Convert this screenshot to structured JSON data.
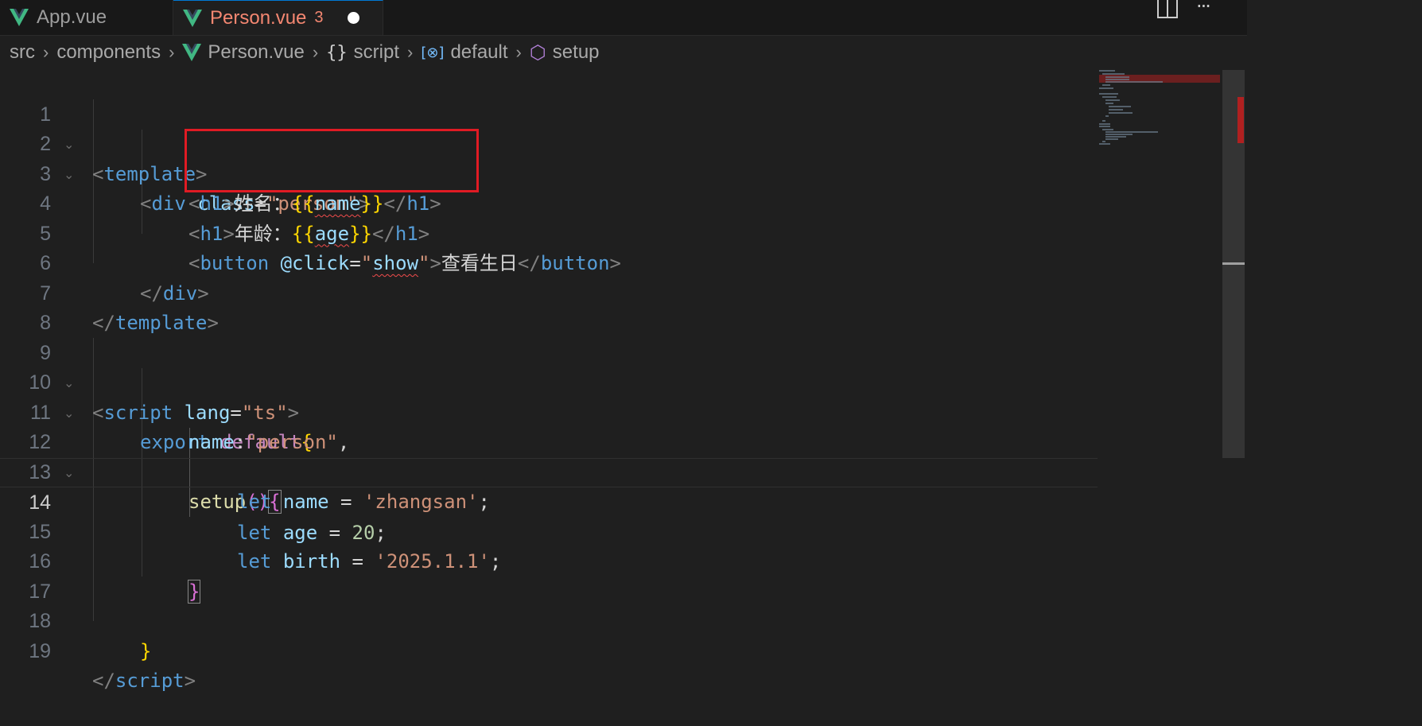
{
  "tabs": [
    {
      "label": "App.vue",
      "active": false
    },
    {
      "label": "Person.vue",
      "active": true,
      "problem_count": "3",
      "unsaved": true
    }
  ],
  "toolbar_icons": [
    "split-editor-icon",
    "more-actions-icon"
  ],
  "toolbar_more_label": "···",
  "breadcrumb": [
    {
      "label": "src"
    },
    {
      "label": "components"
    },
    {
      "label": "Person.vue",
      "icon": "vue-icon"
    },
    {
      "label": "script",
      "icon": "braces-icon",
      "icon_glyph": "{}"
    },
    {
      "label": "default",
      "icon": "namespace-icon",
      "icon_glyph": "[⊗]"
    },
    {
      "label": "setup",
      "icon": "cube-icon",
      "icon_glyph": "⬡"
    }
  ],
  "editor": {
    "current_line": 14,
    "line_numbers": [
      "1",
      "2",
      "3",
      "4",
      "5",
      "6",
      "7",
      "8",
      "9",
      "10",
      "11",
      "12",
      "13",
      "14",
      "15",
      "16",
      "17",
      "18",
      "19"
    ],
    "fold_glyph": "⌄",
    "tokens": {
      "l1": [
        "<",
        "template",
        ">"
      ],
      "l2": [
        "<",
        "div",
        " ",
        "class",
        "=",
        "\"person\"",
        ">"
      ],
      "l3": [
        "<",
        "h1",
        ">",
        "姓名：",
        "{{",
        "name",
        "}}",
        "</",
        "h1",
        ">"
      ],
      "l4": [
        "<",
        "h1",
        ">",
        "年龄：",
        "{{",
        "age",
        "}}",
        "</",
        "h1",
        ">"
      ],
      "l5": [
        "<",
        "button",
        " ",
        "@click",
        "=",
        "\"",
        "show",
        "\"",
        ">",
        "查看生日",
        "</",
        "button",
        ">"
      ],
      "l6": [
        "</",
        "div",
        ">"
      ],
      "l7": [
        "</",
        "template",
        ">"
      ],
      "l9": [
        "<",
        "script",
        " ",
        "lang",
        "=",
        "\"ts\"",
        ">"
      ],
      "l10": [
        "export",
        " ",
        "default",
        "{"
      ],
      "l11": [
        "name",
        ":",
        "\"person\"",
        ","
      ],
      "l12": [
        "setup",
        "()",
        "{"
      ],
      "l13": [
        "let",
        " ",
        "name",
        " = ",
        "'zhangsan'",
        ";"
      ],
      "l14": [
        "let",
        " ",
        "age",
        " = ",
        "20",
        ";"
      ],
      "l15": [
        "let",
        " ",
        "birth",
        " = ",
        "'2025.1.1'",
        ";"
      ],
      "l16": [
        "}"
      ],
      "l18": [
        "}"
      ],
      "l19": [
        "</",
        "script",
        ">"
      ]
    }
  },
  "colors": {
    "background": "#1f1f1f",
    "tab_active_text": "#f48771",
    "highlight_box": "#e01b24",
    "vue_green": "#41b883"
  }
}
